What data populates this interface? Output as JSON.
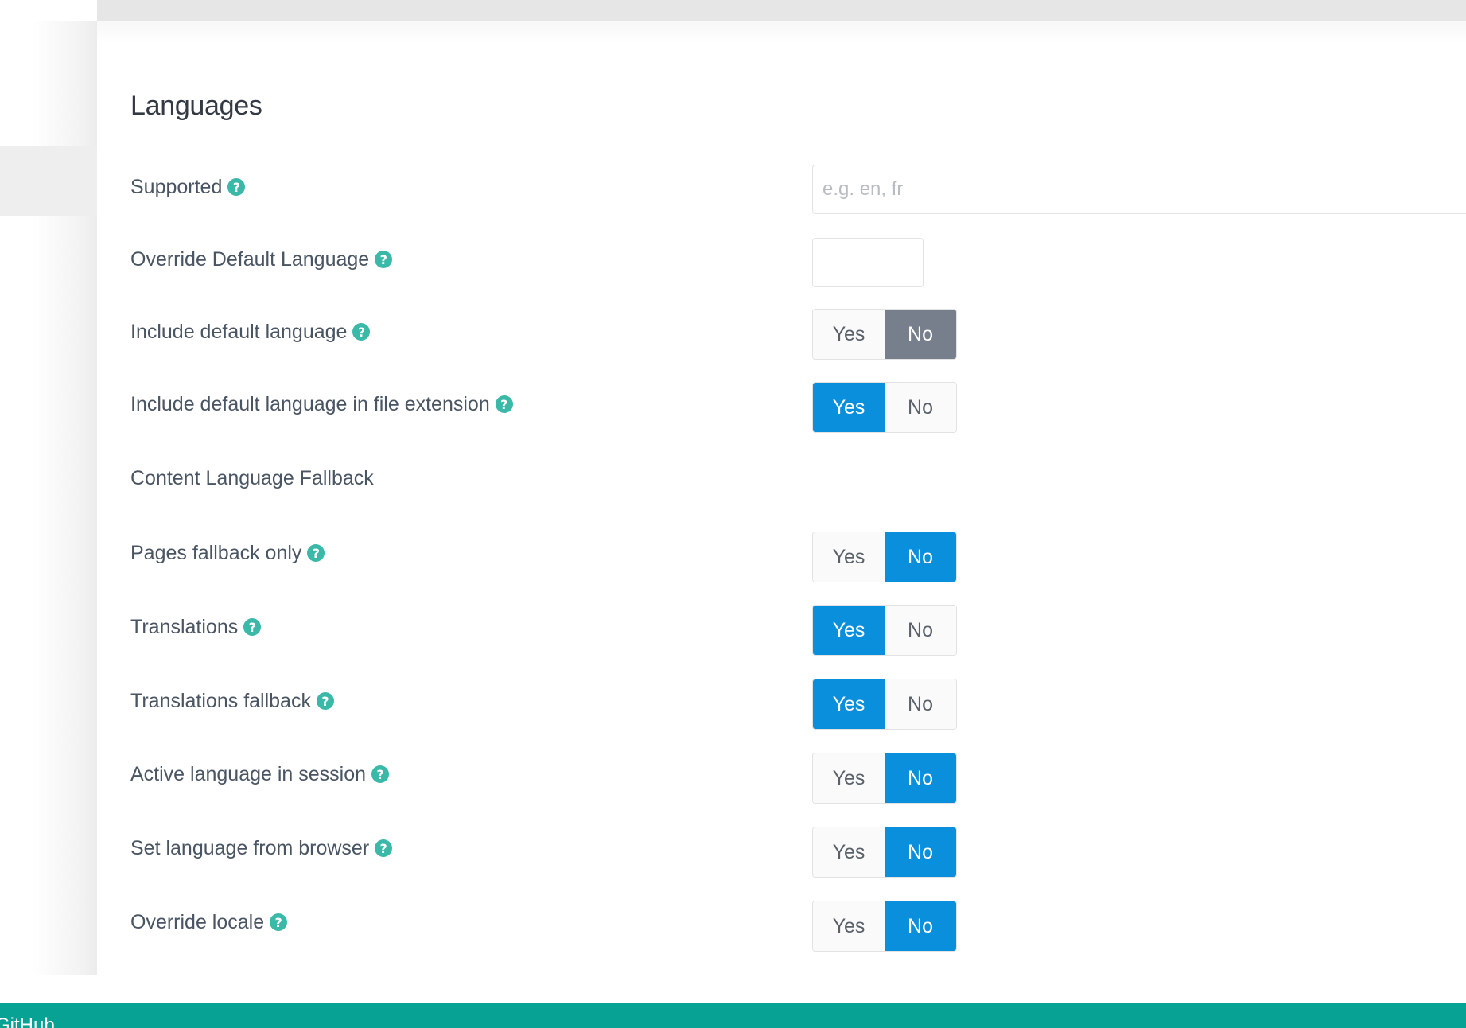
{
  "panel": {
    "title": "Languages"
  },
  "help_icon_glyph": "?",
  "colors": {
    "accent": "#0a8fdc",
    "help_icon": "#3bb9a8",
    "neutral_selected": "#767f8b",
    "footer": "#08a295"
  },
  "fields": {
    "supported": {
      "label": "Supported",
      "value": "",
      "placeholder": "e.g. en, fr"
    },
    "override_default_language": {
      "label": "Override Default Language",
      "value": ""
    },
    "include_default_language": {
      "label": "Include default language",
      "yes": "Yes",
      "no": "No",
      "selected": "No"
    },
    "include_default_language_in_file_extension": {
      "label": "Include default language in file extension",
      "yes": "Yes",
      "no": "No",
      "selected": "Yes"
    },
    "content_language_fallback": {
      "label": "Content Language Fallback"
    },
    "pages_fallback_only": {
      "label": "Pages fallback only",
      "yes": "Yes",
      "no": "No",
      "selected": "No"
    },
    "translations": {
      "label": "Translations",
      "yes": "Yes",
      "no": "No",
      "selected": "Yes"
    },
    "translations_fallback": {
      "label": "Translations fallback",
      "yes": "Yes",
      "no": "No",
      "selected": "Yes"
    },
    "active_language_in_session": {
      "label": "Active language in session",
      "yes": "Yes",
      "no": "No",
      "selected": "No"
    },
    "set_language_from_browser": {
      "label": "Set language from browser",
      "yes": "Yes",
      "no": "No",
      "selected": "No"
    },
    "override_locale": {
      "label": "Override locale",
      "yes": "Yes",
      "no": "No",
      "selected": "No"
    }
  },
  "footer": {
    "link_label": "GitHub"
  }
}
